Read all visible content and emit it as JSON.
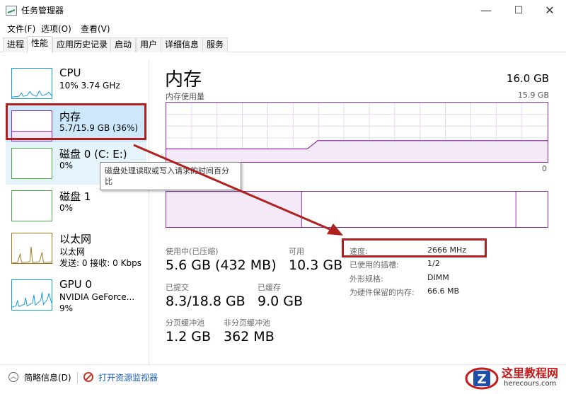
{
  "window": {
    "title": "任务管理器",
    "minimize": "—",
    "maximize": "☐",
    "close": "✕"
  },
  "menu": [
    "文件(F)",
    "选项(O)",
    "查看(V)"
  ],
  "tabs": [
    "进程",
    "性能",
    "应用历史记录",
    "启动",
    "用户",
    "详细信息",
    "服务"
  ],
  "sidebar": {
    "cpu": {
      "title": "CPU",
      "sub": "10% 3.74 GHz"
    },
    "memory": {
      "title": "内存",
      "sub": "5.7/15.9 GB (36%)"
    },
    "disk0": {
      "title": "磁盘 0 (C: E:)",
      "sub": "0%"
    },
    "disk1": {
      "title": "磁盘 1",
      "sub": "0%"
    },
    "ethernet": {
      "title": "以太网",
      "sub": "以太网",
      "sub2": "发送: 0  接收: 0 Kbps"
    },
    "gpu": {
      "title": "GPU 0",
      "sub": "NVIDIA GeForce...",
      "sub2": "9%"
    }
  },
  "tooltip": "磁盘处理读取或写入请求的时间百分比",
  "main": {
    "title": "内存",
    "total": "16.0 GB",
    "graph_label": "内存使用量",
    "graph_max": "15.9 GB",
    "graph_zero": "0",
    "usage_fraction": 0.36,
    "in_use_label": "使用中(已压缩)",
    "in_use_value": "5.6 GB (432 MB)",
    "available_label": "可用",
    "available_value": "10.3 GB",
    "committed_label": "已提交",
    "committed_value": "8.3/18.8 GB",
    "cached_label": "已缓存",
    "cached_value": "9.0 GB",
    "paged_label": "分页缓冲池",
    "paged_value": "1.2 GB",
    "nonpaged_label": "非分页缓冲池",
    "nonpaged_value": "362 MB",
    "details": [
      {
        "label": "速度:",
        "value": "2666 MHz"
      },
      {
        "label": "已使用的插槽:",
        "value": "1/2"
      },
      {
        "label": "外形规格:",
        "value": "DIMM"
      },
      {
        "label": "为硬件保留的内存:",
        "value": "66.6 MB"
      }
    ]
  },
  "footer": {
    "summary": "简略信息(D)",
    "monitor": "打开资源监视器"
  },
  "watermark": {
    "text": "这里教程网",
    "sub": "herecours.com"
  },
  "colors": {
    "memory": "#8b2fa8",
    "cpu": "#139ad3",
    "disk": "#4da848",
    "ethernet": "#a7741d",
    "annotation": "#b0201e"
  }
}
